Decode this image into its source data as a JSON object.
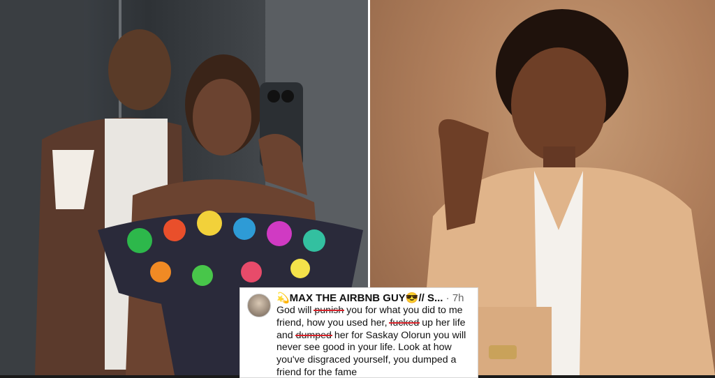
{
  "tweet": {
    "author": "💫MAX THE AIRBNB GUY😎// S...",
    "separator": " · ",
    "time": "7h",
    "line1": "God will ",
    "w1": "punish",
    "line1b": " you for what you did to me friend, how you used her, ",
    "w2": "fucked",
    "line2": " up her life and ",
    "w3": "dumped",
    "line3": " her for Saskay Olorun you will never see good in your life. Look at how you've disgraced yourself, you dumped a friend for the fame"
  }
}
